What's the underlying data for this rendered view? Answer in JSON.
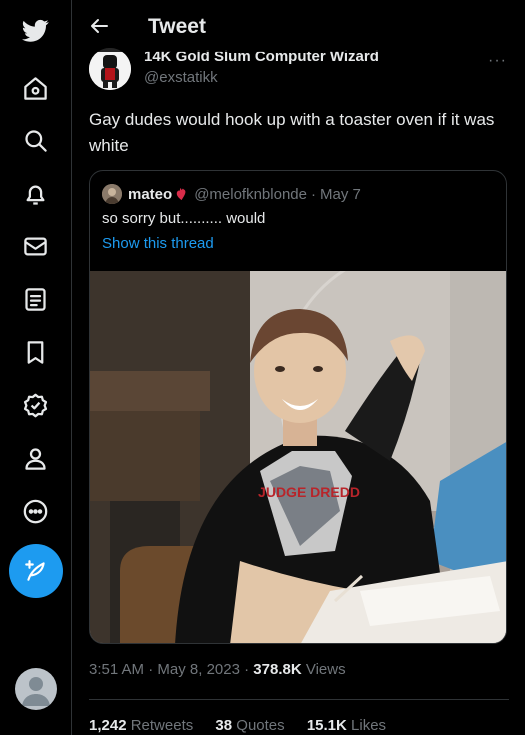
{
  "header": {
    "title": "Tweet"
  },
  "tweet": {
    "author_name": "14K Gold Slum Computer Wizard",
    "author_handle": "@exstatikk",
    "text": "Gay dudes would hook up with a toaster oven if it was white",
    "time": "3:51 AM",
    "date": "May 8, 2023",
    "separator": "·",
    "views_count": "378.8K",
    "views_label": "Views",
    "retweets_count": "1,242",
    "retweets_label": "Retweets",
    "quotes_count": "38",
    "quotes_label": "Quotes",
    "likes_count": "15.1K",
    "likes_label": "Likes"
  },
  "quoted": {
    "name": "mateo",
    "handle": "@melofknblonde",
    "date": "May 7",
    "text": "so sorry but.......... would",
    "link": "Show this thread",
    "shirt_text": "JUDGE DREDD"
  },
  "nav": {
    "icons": [
      "twitter-logo-icon",
      "home-icon",
      "explore-icon",
      "notifications-icon",
      "messages-icon",
      "lists-icon",
      "bookmarks-icon",
      "verified-icon",
      "profile-icon",
      "more-icon"
    ]
  },
  "colors": {
    "accent": "#1d9bf0",
    "background": "#000000",
    "text": "#e7e9ea",
    "muted": "#71767b",
    "border": "#2f3336"
  }
}
